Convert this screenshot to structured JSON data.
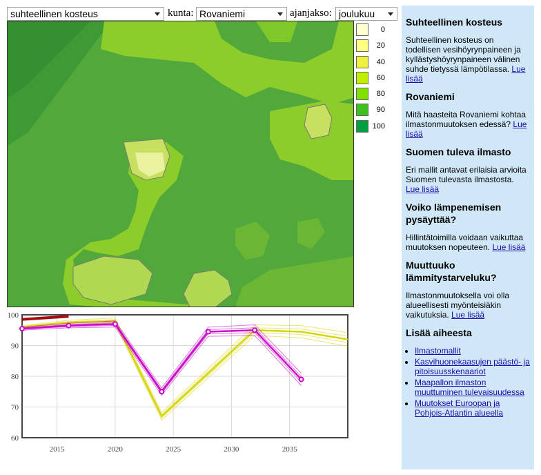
{
  "controls": {
    "variable_select": "suhteellinen kosteus",
    "kunta_label": "kunta:",
    "kunta_select": "Rovaniemi",
    "ajanjakso_label": "ajanjakso:",
    "ajanjakso_select": "joulukuu"
  },
  "legend": [
    {
      "label": "0",
      "color": "#ffffd0"
    },
    {
      "label": "20",
      "color": "#ffff80"
    },
    {
      "label": "40",
      "color": "#f0f040"
    },
    {
      "label": "60",
      "color": "#c0f000"
    },
    {
      "label": "80",
      "color": "#80e000"
    },
    {
      "label": "90",
      "color": "#40c020"
    },
    {
      "label": "100",
      "color": "#00a040"
    }
  ],
  "chart_data": {
    "type": "line",
    "x_ticks": [
      "2015",
      "2020",
      "2025",
      "2030",
      "2035"
    ],
    "y_ticks": [
      "60",
      "70",
      "80",
      "90",
      "100"
    ],
    "ylim": [
      60,
      100
    ],
    "xlim": [
      2012,
      2040
    ],
    "series": [
      {
        "color": "#a00000",
        "x": [
          2012,
          2016
        ],
        "y": [
          98.5,
          99.5
        ]
      },
      {
        "color": "#d4d400",
        "x": [
          2012,
          2016,
          2020,
          2024,
          2028,
          2032,
          2036,
          2040
        ],
        "y": [
          96,
          97.5,
          98,
          67,
          81,
          95,
          94.5,
          92
        ]
      },
      {
        "color": "#c800c8",
        "x": [
          2012,
          2016,
          2020,
          2024,
          2028,
          2032,
          2036
        ],
        "y": [
          95.5,
          96.5,
          97,
          75,
          94.5,
          95,
          79
        ]
      }
    ]
  },
  "sidebar": {
    "sections": [
      {
        "title": "Suhteellinen kosteus",
        "text": "Suhteellinen kosteus on todellisen vesihöyrynpaineen ja kyllästyshöyrynpaineen välinen suhde tietyssä lämpötilassa.",
        "link": "Lue lisää"
      },
      {
        "title": "Rovaniemi",
        "text": "Mitä haasteita Rovaniemi kohtaa ilmastonmuutoksen edessä?",
        "link": "Lue lisää"
      },
      {
        "title": "Suomen tuleva ilmasto",
        "text": "Eri mallit antavat erilaisia arvioita Suomen tulevasta ilmastosta.",
        "link": "Lue lisää"
      },
      {
        "title": "Voiko lämpenemisen pysäyttää?",
        "text": "Hillintätoimilla voidaan vaikuttaa muutoksen nopeuteen.",
        "link": "Lue lisää"
      },
      {
        "title": "Muuttuuko lämmitystarveluku?",
        "text": "Ilmastonmuutoksella voi olla alueellisesti myönteisiäkin vaikutuksia.",
        "link": "Lue lisää"
      }
    ],
    "more_title": "Lisää aiheesta",
    "more_links": [
      "Ilmastomallit",
      "Kasvihuonekaasujen päästö- ja pitoisuusskenaariot",
      "Maapallon ilmaston muuttuminen tulevaisuudessa",
      "Muutokset Euroopan ja Pohjois-Atlantin alueella"
    ]
  }
}
